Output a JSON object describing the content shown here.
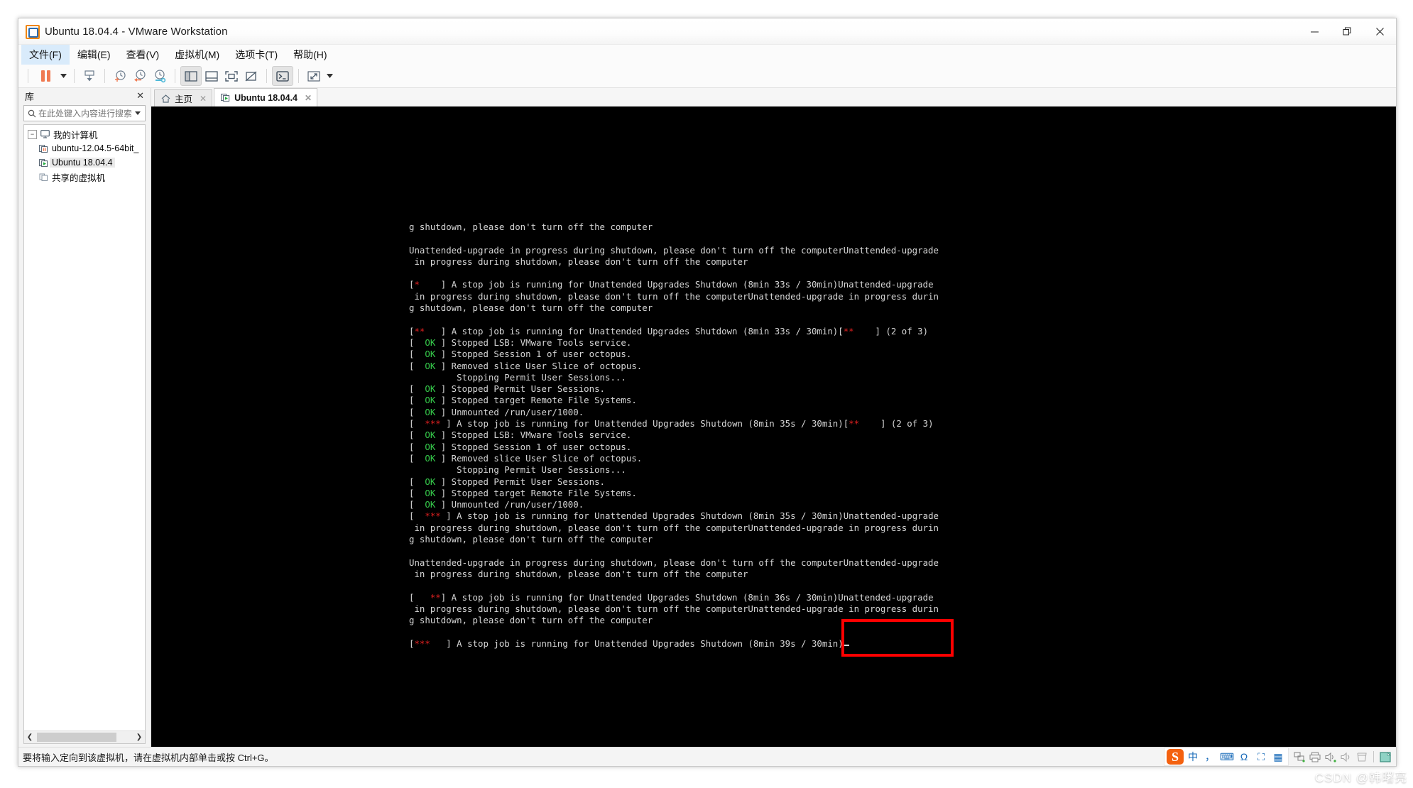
{
  "window": {
    "title": "Ubuntu 18.04.4 - VMware Workstation",
    "app_icon": "vmware-logo-icon",
    "minimize_label": "—",
    "restore_label": "❐",
    "close_label": "✕"
  },
  "menubar": {
    "items": [
      {
        "label": "文件(F)",
        "name": "menu-file"
      },
      {
        "label": "编辑(E)",
        "name": "menu-edit"
      },
      {
        "label": "查看(V)",
        "name": "menu-view"
      },
      {
        "label": "虚拟机(M)",
        "name": "menu-vm"
      },
      {
        "label": "选项卡(T)",
        "name": "menu-tabs"
      },
      {
        "label": "帮助(H)",
        "name": "menu-help"
      }
    ]
  },
  "toolbar": {
    "buttons": [
      {
        "name": "suspend-button",
        "icon": "pause-icon"
      },
      {
        "name": "power-dropdown",
        "icon": "chevron-down-icon"
      },
      {
        "name": "snapshot-button",
        "icon": "snapshot-icon"
      },
      {
        "name": "take-snapshot-button",
        "icon": "clock-plus-icon"
      },
      {
        "name": "revert-snapshot-button",
        "icon": "clock-back-icon"
      },
      {
        "name": "manage-snapshots-button",
        "icon": "clock-wrench-icon"
      },
      {
        "name": "show-library-button",
        "icon": "panel-left-icon"
      },
      {
        "name": "show-thumbnail-bar-button",
        "icon": "panel-bottom-icon"
      },
      {
        "name": "full-screen-button",
        "icon": "fullscreen-icon"
      },
      {
        "name": "unity-mode-button",
        "icon": "unity-off-icon"
      },
      {
        "name": "console-view-button",
        "icon": "console-icon"
      },
      {
        "name": "stretch-button",
        "icon": "expand-arrows-icon"
      },
      {
        "name": "stretch-dropdown",
        "icon": "chevron-down-icon"
      }
    ]
  },
  "sidebar": {
    "title": "库",
    "close_label": "✕",
    "search": {
      "placeholder": "在此处键入内容进行搜索",
      "value": "",
      "icon": "search-icon",
      "dropdown_icon": "chevron-down-icon"
    },
    "tree": [
      {
        "label": "我的计算机",
        "name": "tree-item-my-computer",
        "icon": "monitor-icon",
        "expander": "−",
        "level": 0,
        "selected": false
      },
      {
        "label": "ubuntu-12.04.5-64bit_",
        "name": "tree-item-ubuntu-1204",
        "icon": "vm-suspended-icon",
        "level": 1,
        "selected": false
      },
      {
        "label": "Ubuntu 18.04.4",
        "name": "tree-item-ubuntu-1804",
        "icon": "vm-running-icon",
        "level": 1,
        "selected": true
      },
      {
        "label": "共享的虚拟机",
        "name": "tree-item-shared-vms",
        "icon": "shared-vm-icon",
        "level": 0,
        "selected": false
      }
    ],
    "scrollbar": {
      "left_arrow": "❮",
      "right_arrow": "❯"
    }
  },
  "tabs": [
    {
      "label": "主页",
      "name": "tab-home",
      "icon": "home-icon",
      "active": false,
      "close_label": "✕"
    },
    {
      "label": "Ubuntu 18.04.4",
      "name": "tab-ubuntu-1804",
      "icon": "vm-running-icon",
      "active": true,
      "close_label": "✕"
    }
  ],
  "terminal": {
    "lines": [
      {
        "text": "g shutdown, please don't turn off the computer"
      },
      {
        "text": ""
      },
      {
        "text": "Unattended-upgrade in progress during shutdown, please don't turn off the computerUnattended-upgrade"
      },
      {
        "text": " in progress during shutdown, please don't turn off the computer"
      },
      {
        "text": ""
      },
      {
        "segments": [
          {
            "t": "[",
            "c": "n"
          },
          {
            "t": "*",
            "c": "r"
          },
          {
            "t": "    ] A stop job is running for Unattended Upgrades Shutdown (8min 33s / 30min)Unattended-upgrade",
            "c": "n"
          }
        ]
      },
      {
        "text": " in progress during shutdown, please don't turn off the computerUnattended-upgrade in progress durin"
      },
      {
        "text": "g shutdown, please don't turn off the computer"
      },
      {
        "text": ""
      },
      {
        "segments": [
          {
            "t": "[",
            "c": "n"
          },
          {
            "t": "**",
            "c": "r"
          },
          {
            "t": "   ] A stop job is running for Unattended Upgrades Shutdown (8min 33s / 30min)[",
            "c": "n"
          },
          {
            "t": "**",
            "c": "r"
          },
          {
            "t": "    ] (2 of 3)",
            "c": "n"
          }
        ]
      },
      {
        "segments": [
          {
            "t": "[ ",
            "c": "n"
          },
          {
            "t": " OK ",
            "c": "g"
          },
          {
            "t": "] Stopped LSB: VMware Tools service.",
            "c": "n"
          }
        ]
      },
      {
        "segments": [
          {
            "t": "[ ",
            "c": "n"
          },
          {
            "t": " OK ",
            "c": "g"
          },
          {
            "t": "] Stopped Session 1 of user octopus.",
            "c": "n"
          }
        ]
      },
      {
        "segments": [
          {
            "t": "[ ",
            "c": "n"
          },
          {
            "t": " OK ",
            "c": "g"
          },
          {
            "t": "] Removed slice User Slice of octopus.",
            "c": "n"
          }
        ]
      },
      {
        "text": "         Stopping Permit User Sessions..."
      },
      {
        "segments": [
          {
            "t": "[ ",
            "c": "n"
          },
          {
            "t": " OK ",
            "c": "g"
          },
          {
            "t": "] Stopped Permit User Sessions.",
            "c": "n"
          }
        ]
      },
      {
        "segments": [
          {
            "t": "[ ",
            "c": "n"
          },
          {
            "t": " OK ",
            "c": "g"
          },
          {
            "t": "] Stopped target Remote File Systems.",
            "c": "n"
          }
        ]
      },
      {
        "segments": [
          {
            "t": "[ ",
            "c": "n"
          },
          {
            "t": " OK ",
            "c": "g"
          },
          {
            "t": "] Unmounted /run/user/1000.",
            "c": "n"
          }
        ]
      },
      {
        "segments": [
          {
            "t": "[ ",
            "c": "n"
          },
          {
            "t": " *** ",
            "c": "r"
          },
          {
            "t": "] A stop job is running for Unattended Upgrades Shutdown (8min 35s / 30min)[",
            "c": "n"
          },
          {
            "t": "**",
            "c": "r"
          },
          {
            "t": "    ] (2 of 3)",
            "c": "n"
          }
        ]
      },
      {
        "segments": [
          {
            "t": "[ ",
            "c": "n"
          },
          {
            "t": " OK ",
            "c": "g"
          },
          {
            "t": "] Stopped LSB: VMware Tools service.",
            "c": "n"
          }
        ]
      },
      {
        "segments": [
          {
            "t": "[ ",
            "c": "n"
          },
          {
            "t": " OK ",
            "c": "g"
          },
          {
            "t": "] Stopped Session 1 of user octopus.",
            "c": "n"
          }
        ]
      },
      {
        "segments": [
          {
            "t": "[ ",
            "c": "n"
          },
          {
            "t": " OK ",
            "c": "g"
          },
          {
            "t": "] Removed slice User Slice of octopus.",
            "c": "n"
          }
        ]
      },
      {
        "text": "         Stopping Permit User Sessions..."
      },
      {
        "segments": [
          {
            "t": "[ ",
            "c": "n"
          },
          {
            "t": " OK ",
            "c": "g"
          },
          {
            "t": "] Stopped Permit User Sessions.",
            "c": "n"
          }
        ]
      },
      {
        "segments": [
          {
            "t": "[ ",
            "c": "n"
          },
          {
            "t": " OK ",
            "c": "g"
          },
          {
            "t": "] Stopped target Remote File Systems.",
            "c": "n"
          }
        ]
      },
      {
        "segments": [
          {
            "t": "[ ",
            "c": "n"
          },
          {
            "t": " OK ",
            "c": "g"
          },
          {
            "t": "] Unmounted /run/user/1000.",
            "c": "n"
          }
        ]
      },
      {
        "segments": [
          {
            "t": "[ ",
            "c": "n"
          },
          {
            "t": " *** ",
            "c": "r"
          },
          {
            "t": "] A stop job is running for Unattended Upgrades Shutdown (8min 35s / 30min)Unattended-upgrade",
            "c": "n"
          }
        ]
      },
      {
        "text": " in progress during shutdown, please don't turn off the computerUnattended-upgrade in progress durin"
      },
      {
        "text": "g shutdown, please don't turn off the computer"
      },
      {
        "text": ""
      },
      {
        "text": "Unattended-upgrade in progress during shutdown, please don't turn off the computerUnattended-upgrade"
      },
      {
        "text": " in progress during shutdown, please don't turn off the computer"
      },
      {
        "text": ""
      },
      {
        "segments": [
          {
            "t": "[   ",
            "c": "n"
          },
          {
            "t": "**",
            "c": "r"
          },
          {
            "t": "] A stop job is running for Unattended Upgrades Shutdown (8min 36s / 30min)Unattended-upgrade",
            "c": "n"
          }
        ]
      },
      {
        "text": " in progress during shutdown, please don't turn off the computerUnattended-upgrade in progress durin"
      },
      {
        "text": "g shutdown, please don't turn off the computer"
      },
      {
        "text": ""
      },
      {
        "segments": [
          {
            "t": "[",
            "c": "n"
          },
          {
            "t": "***",
            "c": "r"
          },
          {
            "t": "   ] A stop job is running for Unattended Upgrades Shutdown (8min 39s / 30min)",
            "c": "n"
          },
          {
            "t": "▁",
            "c": "cursor"
          }
        ]
      }
    ],
    "highlight_note": "8min 39s / 30min"
  },
  "statusbar": {
    "message": "要将输入定向到该虚拟机，请在虚拟机内部单击或按 Ctrl+G。",
    "ime": {
      "logo": "S",
      "items": [
        {
          "label": "中",
          "name": "ime-mode-chinese-icon"
        },
        {
          "label": "，",
          "name": "ime-punctuation-icon"
        },
        {
          "label": "⌨",
          "name": "ime-soft-keyboard-icon"
        },
        {
          "label": "Ω",
          "name": "ime-symbol-icon"
        },
        {
          "label": "⛶",
          "name": "ime-screenshot-icon"
        },
        {
          "label": "▦",
          "name": "ime-toolbox-icon"
        }
      ]
    },
    "devices": [
      {
        "name": "network-adapter-icon"
      },
      {
        "name": "printer-icon"
      },
      {
        "name": "sound-card-icon"
      },
      {
        "name": "speaker-icon"
      },
      {
        "name": "removable-devices-icon"
      },
      {
        "name": "vm-display-icon"
      }
    ]
  },
  "watermark": {
    "text": "CSDN @韩曙亮"
  },
  "colors": {
    "accent_orange": "#f0860f",
    "terminal_bg": "#000000",
    "terminal_fg": "#d6d6d6",
    "ok_green": "#35c94a",
    "star_red": "#e02020",
    "annotation_red": "#ff0000"
  }
}
